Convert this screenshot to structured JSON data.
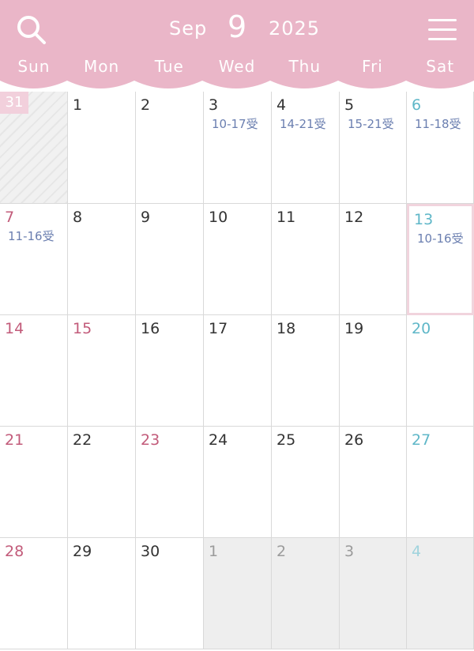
{
  "header": {
    "month_abbr": "Sep",
    "month_number": "9",
    "year": "2025",
    "search_icon": "search-icon",
    "menu_icon": "hamburger-menu-icon",
    "colors": {
      "header_bg": "#eab6c8",
      "sunday": "#c25b7a",
      "saturday": "#5fb7c8",
      "note": "#6b7fb0"
    }
  },
  "weekdays": [
    "Sun",
    "Mon",
    "Tue",
    "Wed",
    "Thu",
    "Fri",
    "Sat"
  ],
  "weeks": [
    [
      {
        "day": "31",
        "note": "",
        "type": "prev"
      },
      {
        "day": "1",
        "note": "",
        "type": "cur"
      },
      {
        "day": "2",
        "note": "",
        "type": "cur"
      },
      {
        "day": "3",
        "note": "10-17受",
        "type": "cur"
      },
      {
        "day": "4",
        "note": "14-21受",
        "type": "cur"
      },
      {
        "day": "5",
        "note": "15-21受",
        "type": "cur"
      },
      {
        "day": "6",
        "note": "11-18受",
        "type": "cur"
      }
    ],
    [
      {
        "day": "7",
        "note": "11-16受",
        "type": "cur"
      },
      {
        "day": "8",
        "note": "",
        "type": "cur"
      },
      {
        "day": "9",
        "note": "",
        "type": "cur"
      },
      {
        "day": "10",
        "note": "",
        "type": "cur"
      },
      {
        "day": "11",
        "note": "",
        "type": "cur"
      },
      {
        "day": "12",
        "note": "",
        "type": "cur"
      },
      {
        "day": "13",
        "note": "10-16受",
        "type": "today"
      }
    ],
    [
      {
        "day": "14",
        "note": "",
        "type": "cur"
      },
      {
        "day": "15",
        "note": "",
        "type": "holiday"
      },
      {
        "day": "16",
        "note": "",
        "type": "cur"
      },
      {
        "day": "17",
        "note": "",
        "type": "cur"
      },
      {
        "day": "18",
        "note": "",
        "type": "cur"
      },
      {
        "day": "19",
        "note": "",
        "type": "cur"
      },
      {
        "day": "20",
        "note": "",
        "type": "cur"
      }
    ],
    [
      {
        "day": "21",
        "note": "",
        "type": "cur"
      },
      {
        "day": "22",
        "note": "",
        "type": "cur"
      },
      {
        "day": "23",
        "note": "",
        "type": "holiday"
      },
      {
        "day": "24",
        "note": "",
        "type": "cur"
      },
      {
        "day": "25",
        "note": "",
        "type": "cur"
      },
      {
        "day": "26",
        "note": "",
        "type": "cur"
      },
      {
        "day": "27",
        "note": "",
        "type": "cur"
      }
    ],
    [
      {
        "day": "28",
        "note": "",
        "type": "cur"
      },
      {
        "day": "29",
        "note": "",
        "type": "cur"
      },
      {
        "day": "30",
        "note": "",
        "type": "cur"
      },
      {
        "day": "1",
        "note": "",
        "type": "next"
      },
      {
        "day": "2",
        "note": "",
        "type": "next"
      },
      {
        "day": "3",
        "note": "",
        "type": "next"
      },
      {
        "day": "4",
        "note": "",
        "type": "next"
      }
    ]
  ]
}
